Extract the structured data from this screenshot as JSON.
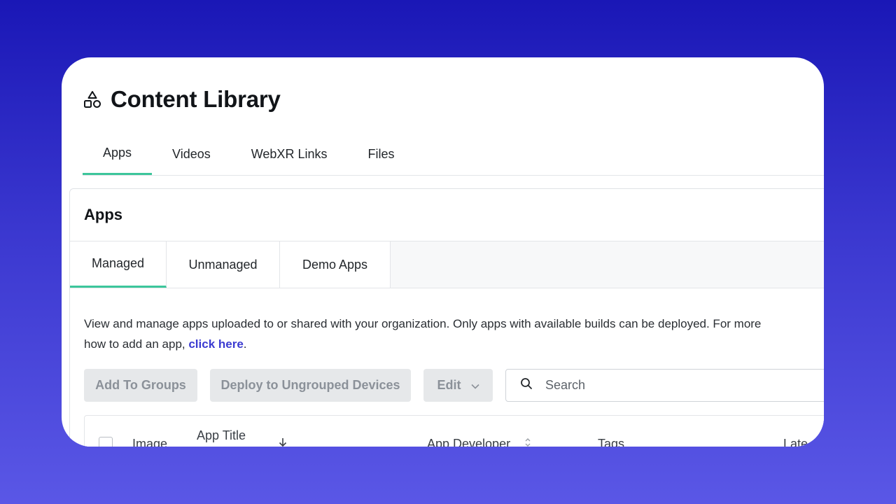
{
  "header": {
    "title": "Content Library",
    "icon": "shapes-icon"
  },
  "top_tabs": [
    {
      "label": "Apps",
      "active": true
    },
    {
      "label": "Videos",
      "active": false
    },
    {
      "label": "WebXR Links",
      "active": false
    },
    {
      "label": "Files",
      "active": false
    }
  ],
  "panel": {
    "title": "Apps",
    "sub_tabs": [
      {
        "label": "Managed",
        "active": true
      },
      {
        "label": "Unmanaged",
        "active": false
      },
      {
        "label": "Demo Apps",
        "active": false
      }
    ],
    "description": {
      "line1": "View and manage apps uploaded to or shared with your organization. Only apps with available builds can be deployed. For more",
      "line2_prefix": "how to add an app, ",
      "link_text": "click here",
      "line2_suffix": "."
    },
    "toolbar": {
      "add_to_groups": "Add To Groups",
      "deploy": "Deploy to Ungrouped Devices",
      "edit": "Edit",
      "search_placeholder": "Search"
    },
    "table": {
      "columns": {
        "image": "Image",
        "app_title": "App Title",
        "app_developer": "App Developer",
        "tags": "Tags",
        "latest": "Late"
      }
    }
  },
  "colors": {
    "accent_green": "#3cc69b",
    "link_blue": "#3b3bd1"
  }
}
